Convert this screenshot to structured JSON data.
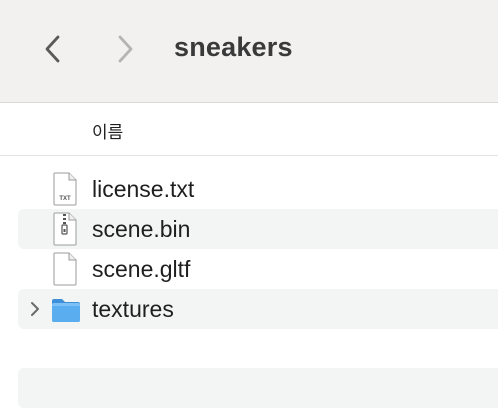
{
  "window": {
    "title": "sneakers"
  },
  "toolbar": {
    "back_icon": "chevron-left-icon",
    "forward_icon": "chevron-right-icon"
  },
  "columns": {
    "name": "이름"
  },
  "files": [
    {
      "name": "license.txt",
      "icon": "text-file-icon",
      "badge": "TXT",
      "kind": "file"
    },
    {
      "name": "scene.bin",
      "icon": "archive-file-icon",
      "kind": "file"
    },
    {
      "name": "scene.gltf",
      "icon": "blank-file-icon",
      "kind": "file"
    },
    {
      "name": "textures",
      "icon": "folder-icon",
      "kind": "folder"
    }
  ],
  "colors": {
    "toolbar_bg": "#f2f1f0",
    "stripe_bg": "#f3f4f4",
    "folder_blue": "#5aaef0"
  }
}
